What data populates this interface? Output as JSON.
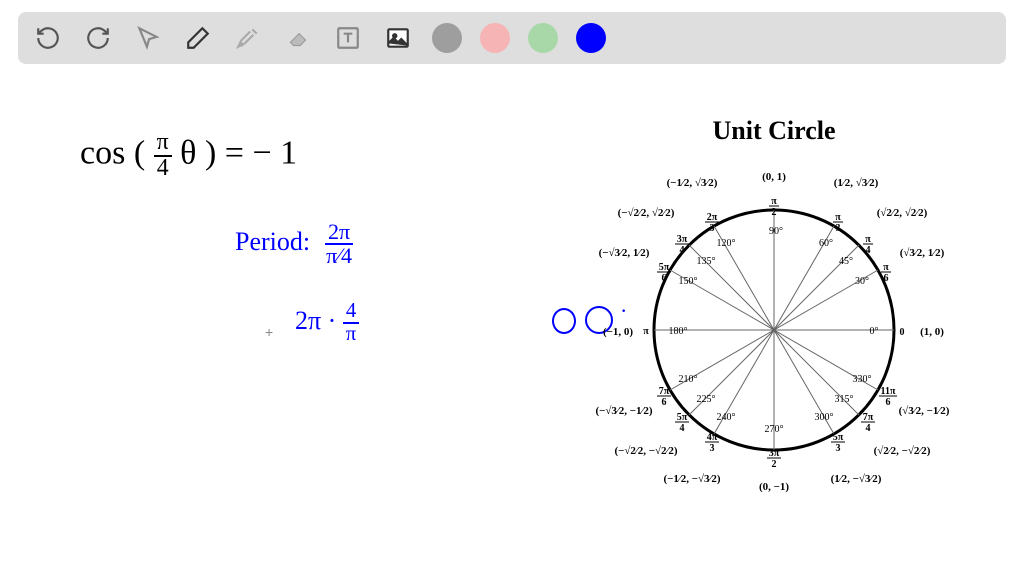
{
  "toolbar": {
    "colors": {
      "gray": "#9e9e9e",
      "pink": "#f6b4b4",
      "green": "#a8d8a8",
      "blue": "#0000ff"
    }
  },
  "equation": {
    "main": "cos ( π⁄4 θ ) = − 1",
    "period_label": "Period:",
    "period_frac_num": "2π",
    "period_frac_den": "π⁄4",
    "simplify": "2π · 4⁄π"
  },
  "unit_circle": {
    "title": "Unit Circle",
    "top_point": "(0, 1)",
    "right_point": "(1, 0)",
    "bottom_point": "(0, −1)",
    "left_point": "(−1, 0)",
    "angles_deg": [
      "0°",
      "30°",
      "45°",
      "60°",
      "90°",
      "120°",
      "135°",
      "150°",
      "180°",
      "210°",
      "225°",
      "240°",
      "270°",
      "300°",
      "315°",
      "330°"
    ],
    "angles_rad": [
      "0",
      "π/6",
      "π/4",
      "π/3",
      "π/2",
      "2π/3",
      "3π/4",
      "5π/6",
      "π",
      "7π/6",
      "5π/4",
      "4π/3",
      "3π/2",
      "5π/3",
      "7π/4",
      "11π/6"
    ]
  }
}
